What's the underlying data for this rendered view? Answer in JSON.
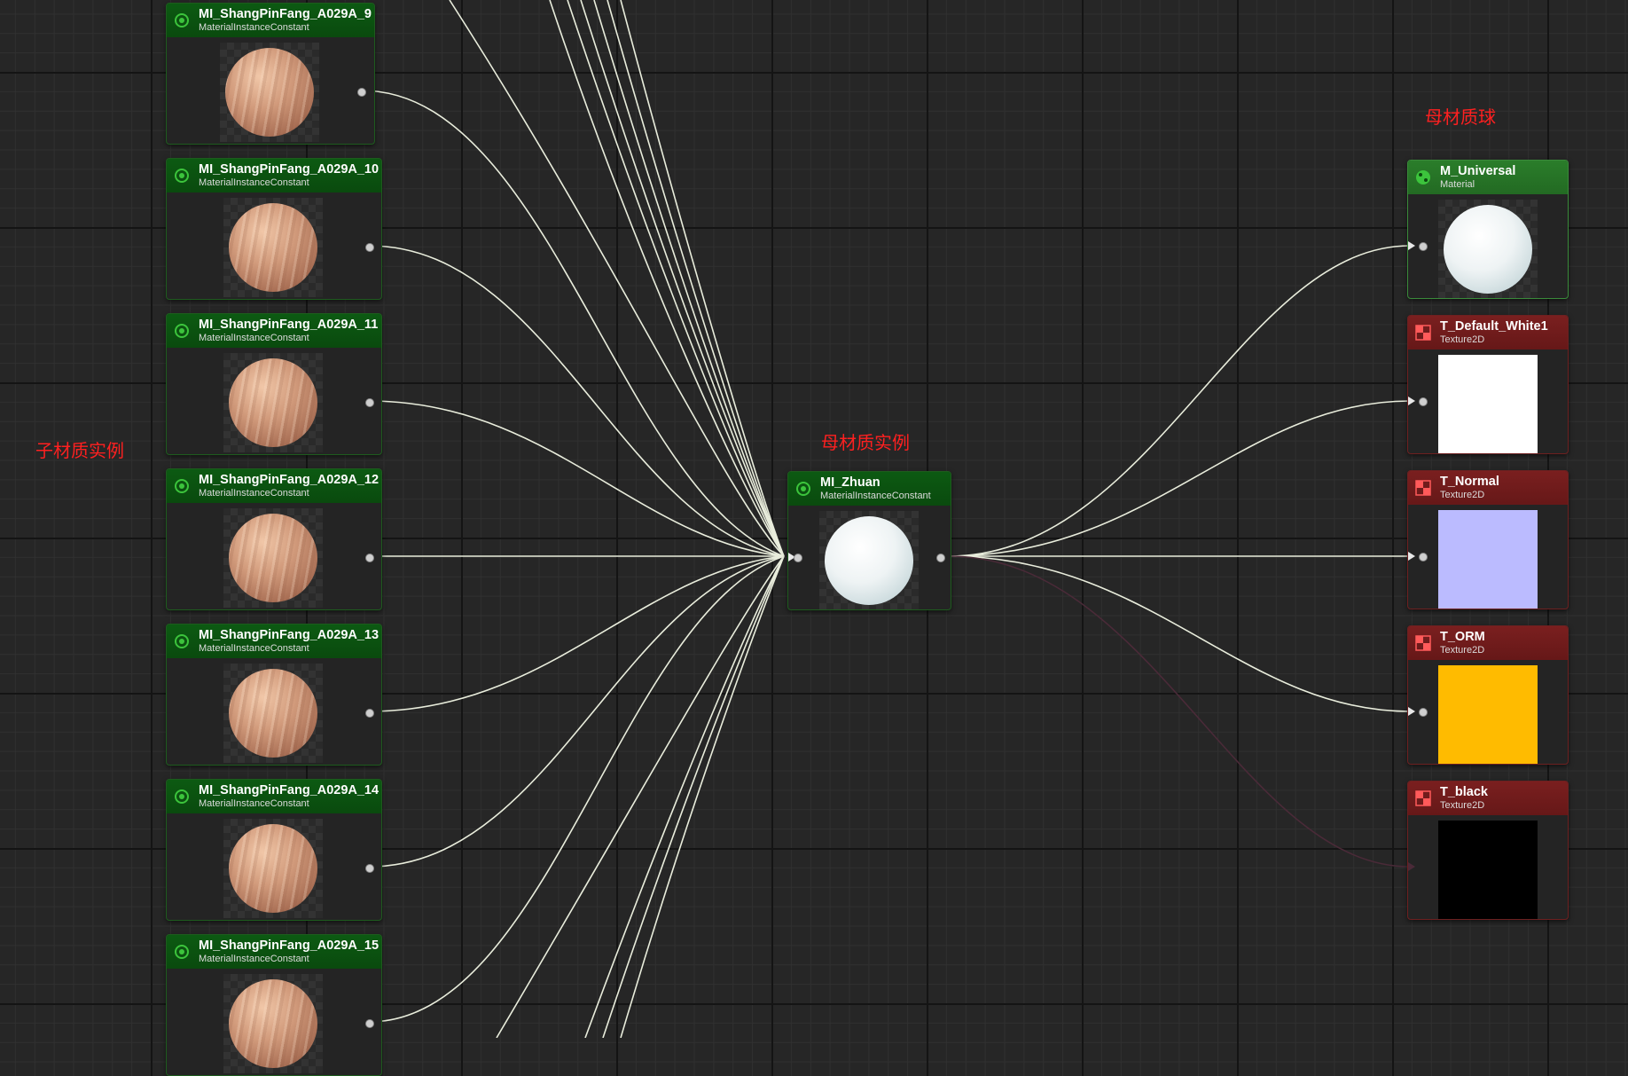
{
  "comments": {
    "child_instances": "子材质实例",
    "parent_instance": "母材质实例",
    "parent_material": "母材质球"
  },
  "child_nodes": [
    {
      "title": "MI_ShangPinFang_A029A_9",
      "subtitle": "MaterialInstanceConstant"
    },
    {
      "title": "MI_ShangPinFang_A029A_10",
      "subtitle": "MaterialInstanceConstant"
    },
    {
      "title": "MI_ShangPinFang_A029A_11",
      "subtitle": "MaterialInstanceConstant"
    },
    {
      "title": "MI_ShangPinFang_A029A_12",
      "subtitle": "MaterialInstanceConstant"
    },
    {
      "title": "MI_ShangPinFang_A029A_13",
      "subtitle": "MaterialInstanceConstant"
    },
    {
      "title": "MI_ShangPinFang_A029A_14",
      "subtitle": "MaterialInstanceConstant"
    },
    {
      "title": "MI_ShangPinFang_A029A_15",
      "subtitle": "MaterialInstanceConstant"
    }
  ],
  "center_node": {
    "title": "MI_Zhuan",
    "subtitle": "MaterialInstanceConstant"
  },
  "right_nodes": [
    {
      "title": "M_Universal",
      "subtitle": "Material",
      "kind": "material",
      "preview": "sphere-white"
    },
    {
      "title": "T_Default_White1",
      "subtitle": "Texture2D",
      "kind": "texture",
      "color": "#ffffff"
    },
    {
      "title": "T_Normal",
      "subtitle": "Texture2D",
      "kind": "texture",
      "color": "#bbbbff"
    },
    {
      "title": "T_ORM",
      "subtitle": "Texture2D",
      "kind": "texture",
      "color": "#ffbb00"
    },
    {
      "title": "T_black",
      "subtitle": "Texture2D",
      "kind": "texture",
      "color": "#000000"
    }
  ],
  "colors": {
    "wire": "#e9eddc",
    "wire_dim": "#4a2a38",
    "instance_header": "#0c5a12",
    "material_header": "#2a7d2a",
    "texture_header": "#7a1f1f",
    "comment_text": "#ff2020"
  },
  "icons": {
    "instance": "material-instance-icon",
    "material": "material-icon",
    "texture": "texture-icon"
  }
}
